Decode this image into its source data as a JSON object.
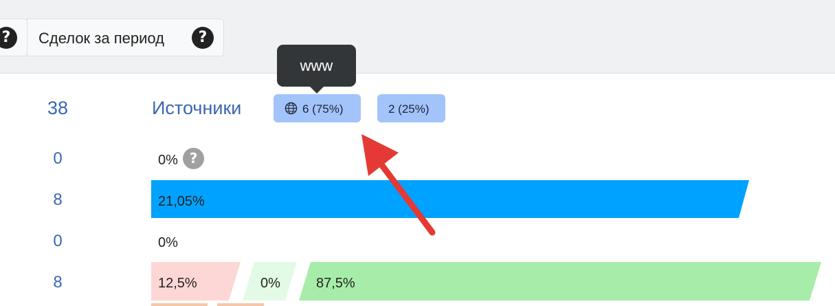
{
  "header": {
    "tab_help_left": "?",
    "tab_deals_label": "Сделок за период",
    "tab_deals_help": "?"
  },
  "counts": [
    "38",
    "0",
    "8",
    "0",
    "8"
  ],
  "sources": {
    "title": "Источники",
    "badge_www": "6 (75%)",
    "badge_other": "2 (25%)",
    "tooltip": "www",
    "icon": "globe-icon"
  },
  "rows": {
    "row1_pct": "0%",
    "row1_help": "?",
    "row2_bar": {
      "label": "21,05%",
      "value": 21.05,
      "color": "#00a2ff"
    },
    "row3_pct": "0%",
    "row4_segments": [
      {
        "label": "12,5%",
        "value": 12.5,
        "color": "#fdd7d5"
      },
      {
        "label": "0%",
        "value": 0,
        "color": "#e3fbe6"
      },
      {
        "label": "87,5%",
        "value": 87.5,
        "color": "#a7eda9"
      }
    ]
  },
  "annotation": {
    "arrow_color": "#e53935"
  }
}
